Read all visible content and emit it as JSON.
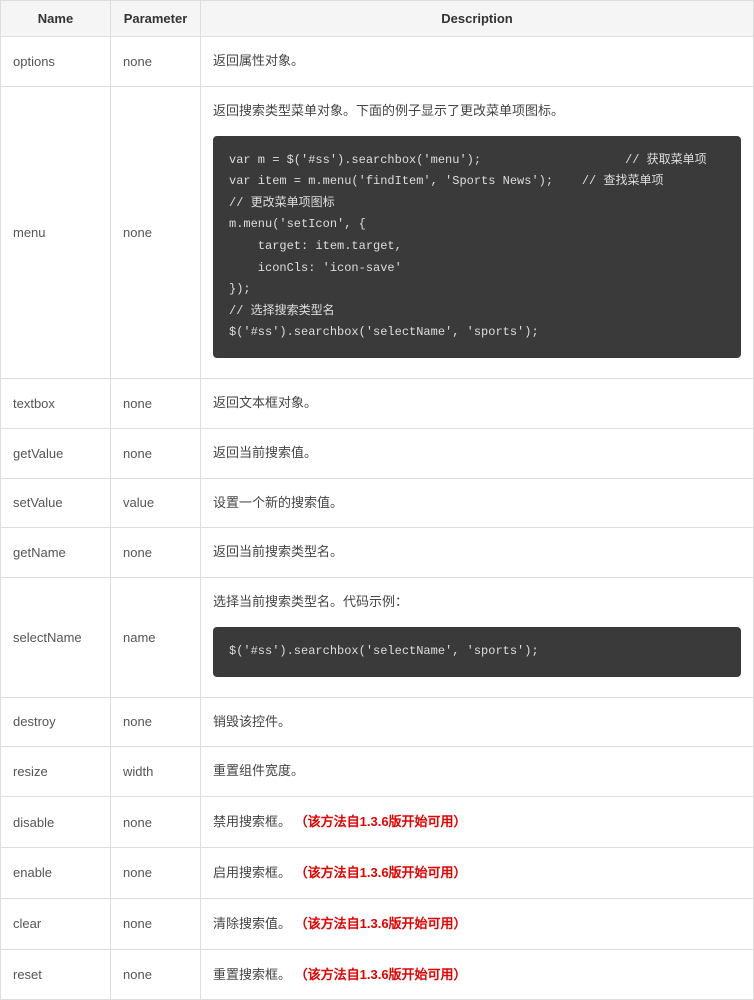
{
  "headers": {
    "name": "Name",
    "parameter": "Parameter",
    "description": "Description"
  },
  "rows": [
    {
      "name": "options",
      "parameter": "none",
      "description": "返回属性对象。"
    },
    {
      "name": "menu",
      "parameter": "none",
      "description": "返回搜索类型菜单对象。下面的例子显示了更改菜单项图标。",
      "code": "var m = $('#ss').searchbox('menu');                    // 获取菜单项\nvar item = m.menu('findItem', 'Sports News');    // 查找菜单项\n// 更改菜单项图标\nm.menu('setIcon', {\n    target: item.target,\n    iconCls: 'icon-save'\n});\n// 选择搜索类型名\n$('#ss').searchbox('selectName', 'sports');"
    },
    {
      "name": "textbox",
      "parameter": "none",
      "description": "返回文本框对象。"
    },
    {
      "name": "getValue",
      "parameter": "none",
      "description": "返回当前搜索值。"
    },
    {
      "name": "setValue",
      "parameter": "value",
      "description": "设置一个新的搜索值。"
    },
    {
      "name": "getName",
      "parameter": "none",
      "description": "返回当前搜索类型名。"
    },
    {
      "name": "selectName",
      "parameter": "name",
      "description": "选择当前搜索类型名。代码示例：",
      "code": "$('#ss').searchbox('selectName', 'sports');"
    },
    {
      "name": "destroy",
      "parameter": "none",
      "description": "销毁该控件。"
    },
    {
      "name": "resize",
      "parameter": "width",
      "description": "重置组件宽度。"
    },
    {
      "name": "disable",
      "parameter": "none",
      "description": "禁用搜索框。",
      "note": "（该方法自1.3.6版开始可用）"
    },
    {
      "name": "enable",
      "parameter": "none",
      "description": "启用搜索框。",
      "note": "（该方法自1.3.6版开始可用）"
    },
    {
      "name": "clear",
      "parameter": "none",
      "description": "清除搜索值。",
      "note": "（该方法自1.3.6版开始可用）"
    },
    {
      "name": "reset",
      "parameter": "none",
      "description": "重置搜索框。",
      "note": "（该方法自1.3.6版开始可用）"
    }
  ]
}
